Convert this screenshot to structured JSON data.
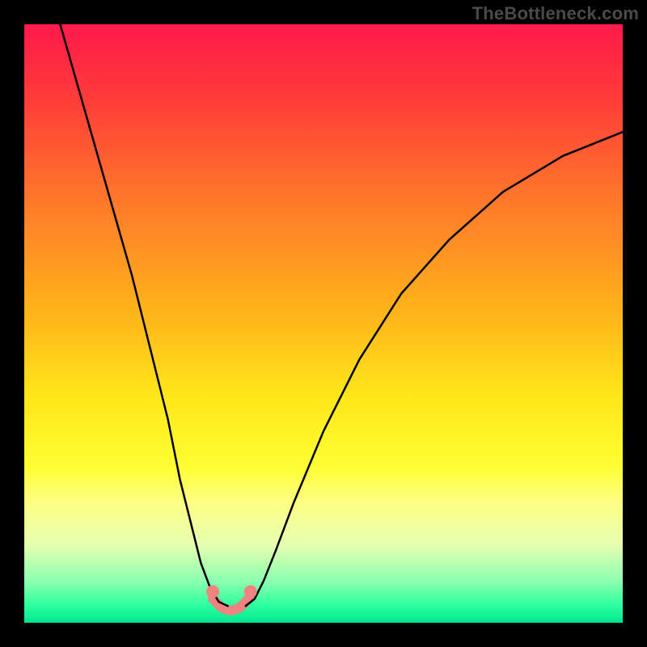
{
  "watermark": "TheBottleneck.com",
  "chart_data": {
    "type": "line",
    "title": "",
    "xlabel": "",
    "ylabel": "",
    "xlim": [
      0,
      100
    ],
    "ylim": [
      0,
      100
    ],
    "grid": false,
    "legend": false,
    "gradient_stops": [
      {
        "offset": 0.0,
        "color": "#ff1a4b"
      },
      {
        "offset": 0.12,
        "color": "#ff3a3a"
      },
      {
        "offset": 0.3,
        "color": "#ff7a2a"
      },
      {
        "offset": 0.48,
        "color": "#ffb31a"
      },
      {
        "offset": 0.62,
        "color": "#ffe61a"
      },
      {
        "offset": 0.74,
        "color": "#ffff33"
      },
      {
        "offset": 0.8,
        "color": "#feff86"
      },
      {
        "offset": 0.87,
        "color": "#e6ffb0"
      },
      {
        "offset": 0.93,
        "color": "#8dffb0"
      },
      {
        "offset": 0.97,
        "color": "#2eff9e"
      },
      {
        "offset": 1.0,
        "color": "#00e890"
      }
    ],
    "series": [
      {
        "name": "curve-left",
        "color": "#000000",
        "width": 2.5,
        "x": [
          6,
          10,
          14,
          18,
          21,
          24,
          26,
          28,
          29.5,
          31,
          32.5,
          34
        ],
        "values": [
          100,
          86,
          72,
          58,
          46,
          34,
          24,
          16,
          10,
          6,
          3.5,
          2.8
        ]
      },
      {
        "name": "curve-right",
        "color": "#000000",
        "width": 2.5,
        "x": [
          37,
          38.5,
          40,
          42,
          45,
          50,
          56,
          63,
          71,
          80,
          90,
          100
        ],
        "values": [
          2.8,
          4,
          7,
          12,
          20,
          32,
          44,
          55,
          64,
          72,
          78,
          82
        ]
      },
      {
        "name": "bottom-marker-band",
        "color": "#ef8380",
        "width": 12,
        "x": [
          31.5,
          33,
          34.5,
          36,
          37.5
        ],
        "values": [
          4,
          2.5,
          2,
          2.5,
          4
        ]
      }
    ],
    "points": [
      {
        "name": "dot-left",
        "x": 31.5,
        "y": 5.2,
        "r": 8,
        "color": "#ef8380"
      },
      {
        "name": "dot-right",
        "x": 37.8,
        "y": 5.2,
        "r": 8,
        "color": "#ef8380"
      }
    ]
  }
}
